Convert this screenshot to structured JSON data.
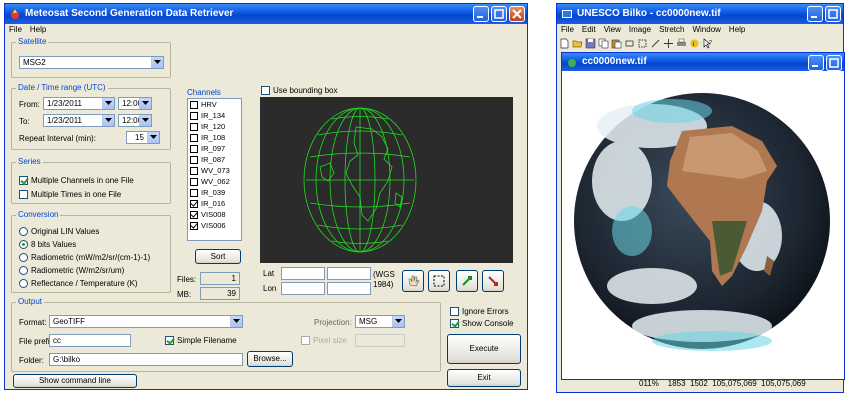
{
  "msg_window": {
    "title": "Meteosat Second Generation Data Retriever",
    "menu": [
      "File",
      "Help"
    ],
    "satellite": {
      "group_title": "Satellite",
      "value": "MSG2"
    },
    "date_range": {
      "group_title": "Date / Time range (UTC)",
      "from_label": "From:",
      "from_date": "1/23/2011",
      "from_time": "12:00",
      "to_label": "To:",
      "to_date": "1/23/2011",
      "to_time": "12:00",
      "repeat_label": "Repeat Interval (min):",
      "repeat_value": "15"
    },
    "series": {
      "group_title": "Series",
      "multi_channels": {
        "label": "Multiple Channels in one File",
        "checked": true
      },
      "multi_times": {
        "label": "Multiple Times in one File",
        "checked": false
      }
    },
    "conversion": {
      "group_title": "Conversion",
      "options": [
        {
          "label": "Original LIN Values",
          "selected": false
        },
        {
          "label": "8 bits Values",
          "selected": true
        },
        {
          "label": "Radiometric (mW/m2/sr/(cm-1)-1)",
          "selected": false
        },
        {
          "label": "Radiometric (W/m2/sr/um)",
          "selected": false
        },
        {
          "label": "Reflectance / Temperature (K)",
          "selected": false
        }
      ]
    },
    "channels": {
      "label": "Channels",
      "items": [
        {
          "name": "HRV",
          "checked": false
        },
        {
          "name": "IR_134",
          "checked": false
        },
        {
          "name": "IR_120",
          "checked": false
        },
        {
          "name": "IR_108",
          "checked": false
        },
        {
          "name": "IR_097",
          "checked": false
        },
        {
          "name": "IR_087",
          "checked": false
        },
        {
          "name": "WV_073",
          "checked": false
        },
        {
          "name": "WV_062",
          "checked": false
        },
        {
          "name": "IR_039",
          "checked": false
        },
        {
          "name": "IR_016",
          "checked": true
        },
        {
          "name": "VIS008",
          "checked": true
        },
        {
          "name": "VIS006",
          "checked": true
        }
      ],
      "sort_label": "Sort",
      "files_label": "Files:",
      "files_value": "1",
      "mb_label": "MB:",
      "mb_value": "39"
    },
    "bounding_box": {
      "label": "Use bounding box",
      "checked": false,
      "lat_label": "Lat",
      "lon_label": "Lon",
      "datum_label": "(WGS\n1984)"
    },
    "output": {
      "group_title": "Output",
      "format_label": "Format:",
      "format_value": "GeoTIFF",
      "prefix_label": "File prefix:",
      "prefix_value": "cc",
      "simple_filename": {
        "label": "Simple Filename",
        "checked": true
      },
      "folder_label": "Folder:",
      "folder_value": "G:\\bilko",
      "browse_label": "Browse...",
      "projection_label": "Projection:",
      "projection_value": "MSG",
      "pixel_size_label": "Pixel size"
    },
    "ignore_errors": {
      "label": "Ignore Errors",
      "checked": false
    },
    "show_console": {
      "label": "Show Console",
      "checked": true
    },
    "execute_label": "Execute",
    "exit_label": "Exit",
    "show_command_label": "Show command line"
  },
  "bilko_window": {
    "title": "UNESCO Bilko - cc0000new.tif",
    "menu": [
      "File",
      "Edit",
      "View",
      "Image",
      "Stretch",
      "Window",
      "Help"
    ],
    "child_title": "cc0000new.tif",
    "status": "011%    1853  1502  105,075,069  105,075,069"
  },
  "colors": {
    "title_blue": "#0a54e3",
    "group_title": "#0046d5",
    "grid_green": "#22dd22"
  }
}
